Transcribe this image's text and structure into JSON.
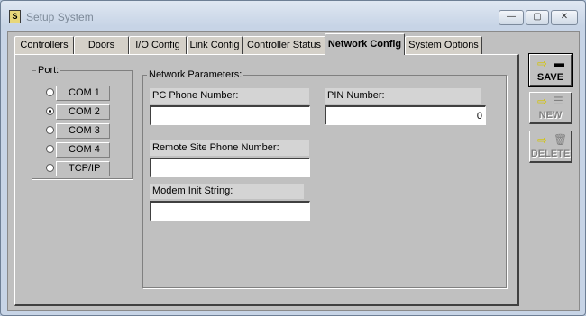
{
  "window": {
    "title": "Setup System"
  },
  "window_controls": {
    "minimize": "—",
    "maximize": "▢",
    "close": "✕"
  },
  "tabs": [
    {
      "label": "Controllers",
      "active": false
    },
    {
      "label": "Doors",
      "active": false
    },
    {
      "label": "I/O Config",
      "active": false
    },
    {
      "label": "Link Config",
      "active": false
    },
    {
      "label": "Controller Status",
      "active": false
    },
    {
      "label": "Network Config",
      "active": true
    },
    {
      "label": "System Options",
      "active": false
    }
  ],
  "port": {
    "label": "Port:",
    "options": [
      {
        "label": "COM 1",
        "checked": false
      },
      {
        "label": "COM 2",
        "checked": true
      },
      {
        "label": "COM 3",
        "checked": false
      },
      {
        "label": "COM 4",
        "checked": false
      },
      {
        "label": "TCP/IP",
        "checked": false
      }
    ]
  },
  "network": {
    "label": "Network Parameters:",
    "pc_phone_label": "PC Phone Number:",
    "pc_phone_value": "",
    "pin_label": "PIN Number:",
    "pin_value": "0",
    "remote_phone_label": "Remote Site Phone Number:",
    "remote_phone_value": "",
    "modem_init_label": "Modem Init String:",
    "modem_init_value": ""
  },
  "actions": {
    "save": "SAVE",
    "new": "NEW",
    "delete": "DELETE",
    "arrow_glyph": "⇨",
    "save_icon": "▬",
    "list_icon": "☰",
    "trash_icon": "🗑"
  }
}
